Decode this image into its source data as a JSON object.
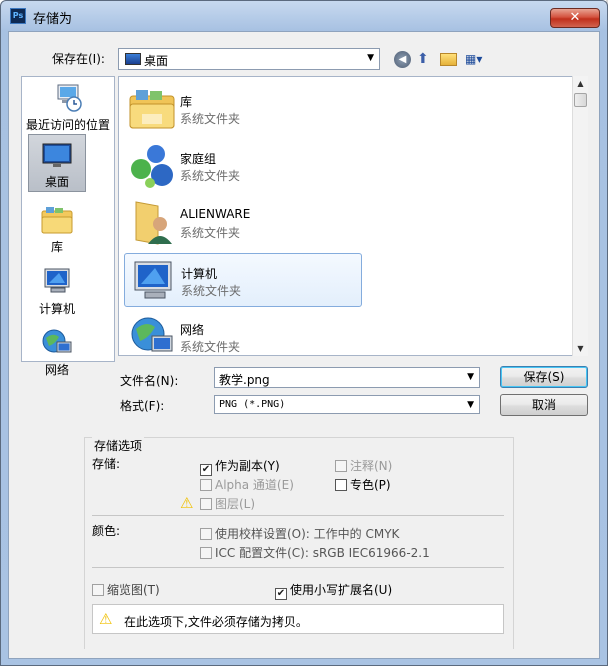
{
  "window": {
    "title": "存储为",
    "close_glyph": "✕",
    "logo_text": "Ps"
  },
  "toolbar": {
    "save_in_label": "保存在(I):",
    "location": "桌面"
  },
  "places": [
    {
      "label": "最近访问的位置",
      "icon": "recent-places-icon"
    },
    {
      "label": "桌面",
      "icon": "desktop-icon",
      "selected": true
    },
    {
      "label": "库",
      "icon": "libraries-icon"
    },
    {
      "label": "计算机",
      "icon": "computer-icon"
    },
    {
      "label": "网络",
      "icon": "network-icon"
    }
  ],
  "files": [
    {
      "name": "库",
      "type": "系统文件夹",
      "icon": "libraries-icon"
    },
    {
      "name": "家庭组",
      "type": "系统文件夹",
      "icon": "homegroup-icon"
    },
    {
      "name": "ALIENWARE",
      "type": "系统文件夹",
      "icon": "user-folder-icon"
    },
    {
      "name": "计算机",
      "type": "系统文件夹",
      "icon": "computer-icon",
      "selected": true
    },
    {
      "name": "网络",
      "type": "系统文件夹",
      "icon": "network-icon"
    }
  ],
  "form": {
    "filename_label": "文件名(N):",
    "filename_value": "教学.png",
    "format_label": "格式(F):",
    "format_value": "PNG (*.PNG)",
    "save_button": "保存(S)",
    "cancel_button": "取消"
  },
  "options": {
    "group_title": "存储选项",
    "storage_label": "存储:",
    "as_copy": "作为副本(Y)",
    "notes": "注释(N)",
    "alpha": "Alpha 通道(E)",
    "spot": "专色(P)",
    "layers": "图层(L)",
    "color_label": "颜色:",
    "proof": "使用校样设置(O): 工作中的 CMYK",
    "icc": "ICC 配置文件(C): sRGB IEC61966-2.1",
    "thumbnail": "缩览图(T)",
    "lowercase": "使用小写扩展名(U)",
    "warning_message": "在此选项下,文件必须存储为拷贝。"
  }
}
